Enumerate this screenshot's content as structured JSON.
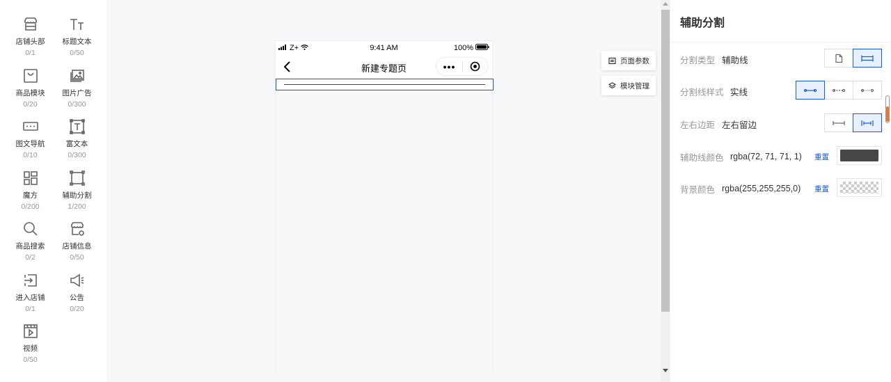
{
  "palette": {
    "items": [
      {
        "name": "店铺头部",
        "count": "0/1",
        "icon": "shop-header-icon"
      },
      {
        "name": "标题文本",
        "count": "0/50",
        "icon": "title-text-icon"
      },
      {
        "name": "商品模块",
        "count": "0/20",
        "icon": "goods-module-icon"
      },
      {
        "name": "图片广告",
        "count": "0/300",
        "icon": "image-ad-icon"
      },
      {
        "name": "图文导航",
        "count": "0/10",
        "icon": "image-nav-icon"
      },
      {
        "name": "富文本",
        "count": "0/300",
        "icon": "rich-text-icon"
      },
      {
        "name": "魔方",
        "count": "0/200",
        "icon": "cube-icon"
      },
      {
        "name": "辅助分割",
        "count": "1/200",
        "icon": "divider-icon"
      },
      {
        "name": "商品搜索",
        "count": "0/2",
        "icon": "search-icon"
      },
      {
        "name": "店铺信息",
        "count": "0/50",
        "icon": "shop-info-icon"
      },
      {
        "name": "进入店铺",
        "count": "0/1",
        "icon": "enter-shop-icon"
      },
      {
        "name": "公告",
        "count": "0/20",
        "icon": "notice-icon"
      },
      {
        "name": "视频",
        "count": "0/50",
        "icon": "video-icon"
      }
    ]
  },
  "phone": {
    "carrier": "Z+",
    "time": "9:41 AM",
    "battery": "100%",
    "title": "新建专题页",
    "more": "•••"
  },
  "side_buttons": {
    "page_params": "页面参数",
    "module_manage": "模块管理"
  },
  "panel": {
    "title": "辅助分割",
    "divider_type": {
      "label": "分割类型",
      "value": "辅助线",
      "selected": "line"
    },
    "line_style": {
      "label": "分割线样式",
      "value": "实线",
      "selected": "solid"
    },
    "margin": {
      "label": "左右边距",
      "value": "左右留边",
      "selected": "padded"
    },
    "line_color": {
      "label": "辅助线颜色",
      "value": "rgba(72, 71, 71, 1)",
      "reset": "重置",
      "color": "#484747"
    },
    "bg_color": {
      "label": "背景颜色",
      "value": "rgba(255,255,255,0)",
      "reset": "重置"
    }
  },
  "colors": {
    "accent": "#155bd4",
    "scroll_accent": "#e97b2c"
  }
}
